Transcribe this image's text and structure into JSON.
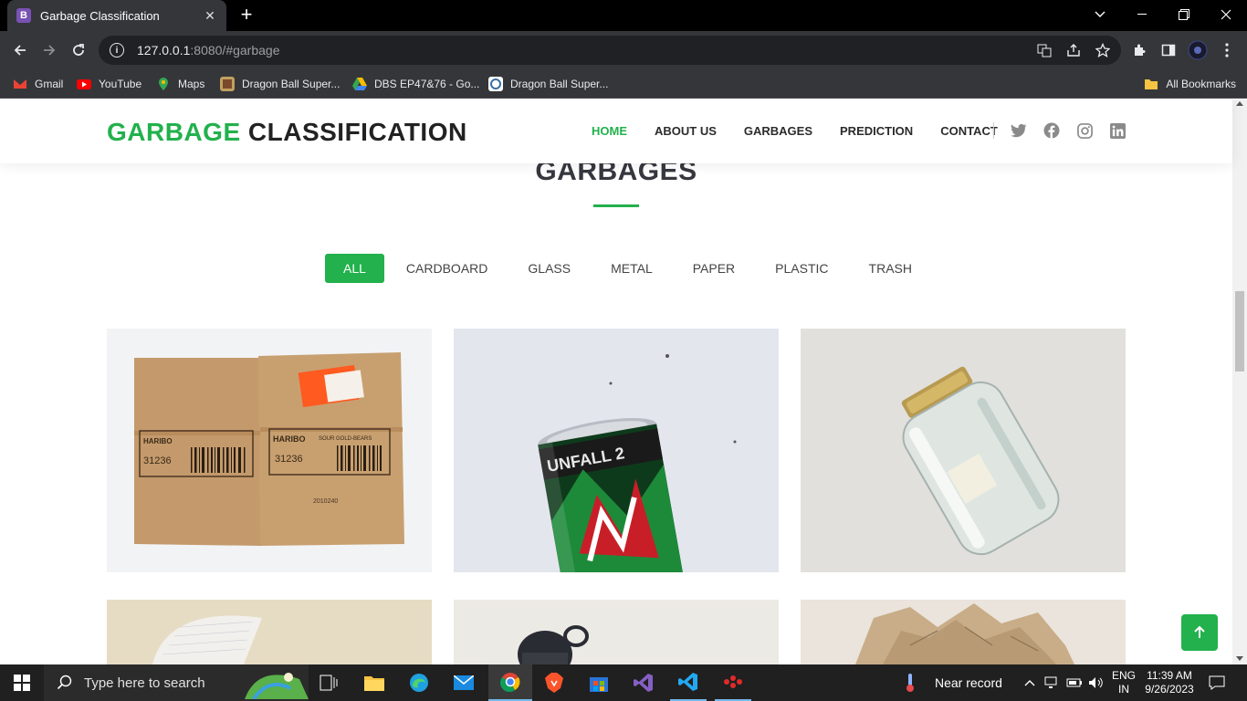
{
  "browser": {
    "tab_title": "Garbage Classification",
    "tab_icon_letter": "B",
    "url_host": "127.0.0.1",
    "url_rest": ":8080/#garbage",
    "bookmarks": [
      {
        "label": "Gmail",
        "color": "#ea4335"
      },
      {
        "label": "YouTube",
        "color": "#ff0000"
      },
      {
        "label": "Maps",
        "color": "#34a853"
      },
      {
        "label": "Dragon Ball Super...",
        "color": "#c0a060"
      },
      {
        "label": "DBS EP47&76 - Go...",
        "color": "#fbbc04"
      },
      {
        "label": "Dragon Ball Super...",
        "color": "#ffffff"
      }
    ],
    "all_bookmarks": "All Bookmarks"
  },
  "header": {
    "logo_green": "GARBAGE",
    "logo_dark": "CLASSIFICATION",
    "nav": [
      "HOME",
      "ABOUT US",
      "GARBAGES",
      "PREDICTION",
      "CONTACT"
    ],
    "active_nav": "HOME",
    "social_icons": [
      "twitter-icon",
      "facebook-icon",
      "instagram-icon",
      "linkedin-icon"
    ]
  },
  "section": {
    "title": "GARBAGES",
    "filters": [
      "ALL",
      "CARDBOARD",
      "GLASS",
      "METAL",
      "PAPER",
      "PLASTIC",
      "TRASH"
    ],
    "active_filter": "ALL"
  },
  "gallery": [
    {
      "category": "cardboard",
      "label_1": "HARIBO",
      "label_2": "SOUR GOLD-BEARS",
      "code": "31236",
      "stamp": "2010240"
    },
    {
      "category": "metal",
      "label": "UNFALL 2"
    },
    {
      "category": "glass"
    },
    {
      "category": "paper"
    },
    {
      "category": "plastic"
    },
    {
      "category": "paper"
    }
  ],
  "accent_color": "#22b14c",
  "taskbar": {
    "search_placeholder": "Type here to search",
    "weather": "Near record",
    "lang_1": "ENG",
    "lang_2": "IN",
    "time": "11:39 AM",
    "date": "9/26/2023"
  }
}
